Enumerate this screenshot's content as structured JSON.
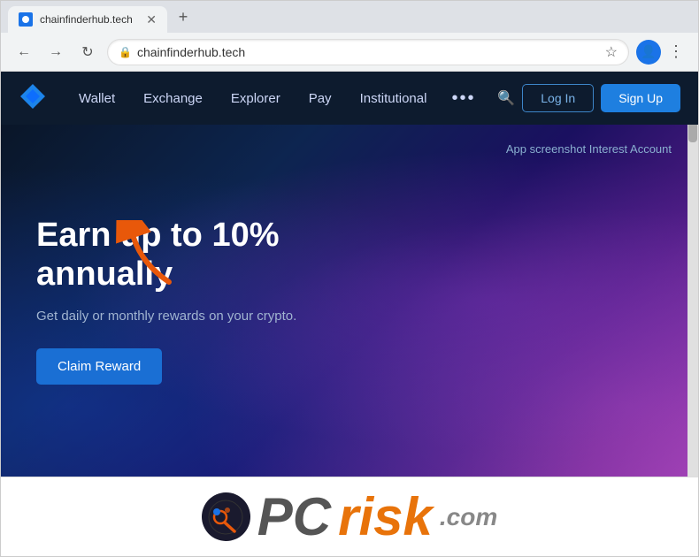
{
  "browser": {
    "tab": {
      "title": "chainfinderhub.tech",
      "favicon_label": "site-favicon"
    },
    "address": "chainfinderhub.tech",
    "new_tab_label": "+",
    "back_label": "←",
    "forward_label": "→",
    "refresh_label": "↻"
  },
  "nav": {
    "logo_label": "ChainFinderHub Logo",
    "items": [
      {
        "label": "Wallet",
        "id": "wallet"
      },
      {
        "label": "Exchange",
        "id": "exchange"
      },
      {
        "label": "Explorer",
        "id": "explorer"
      },
      {
        "label": "Pay",
        "id": "pay"
      },
      {
        "label": "Institutional",
        "id": "institutional"
      }
    ],
    "more_label": "•••",
    "login_label": "Log In",
    "signup_label": "Sign Up"
  },
  "hero": {
    "title": "Earn up to 10% annually",
    "subtitle": "Get daily or monthly rewards on your crypto.",
    "cta_label": "Claim Reward",
    "app_screenshot_alt": "App screenshot Interest Account"
  },
  "watermark": {
    "pc_text": "PC",
    "risk_text": "risk",
    "dot_com": ".com"
  }
}
